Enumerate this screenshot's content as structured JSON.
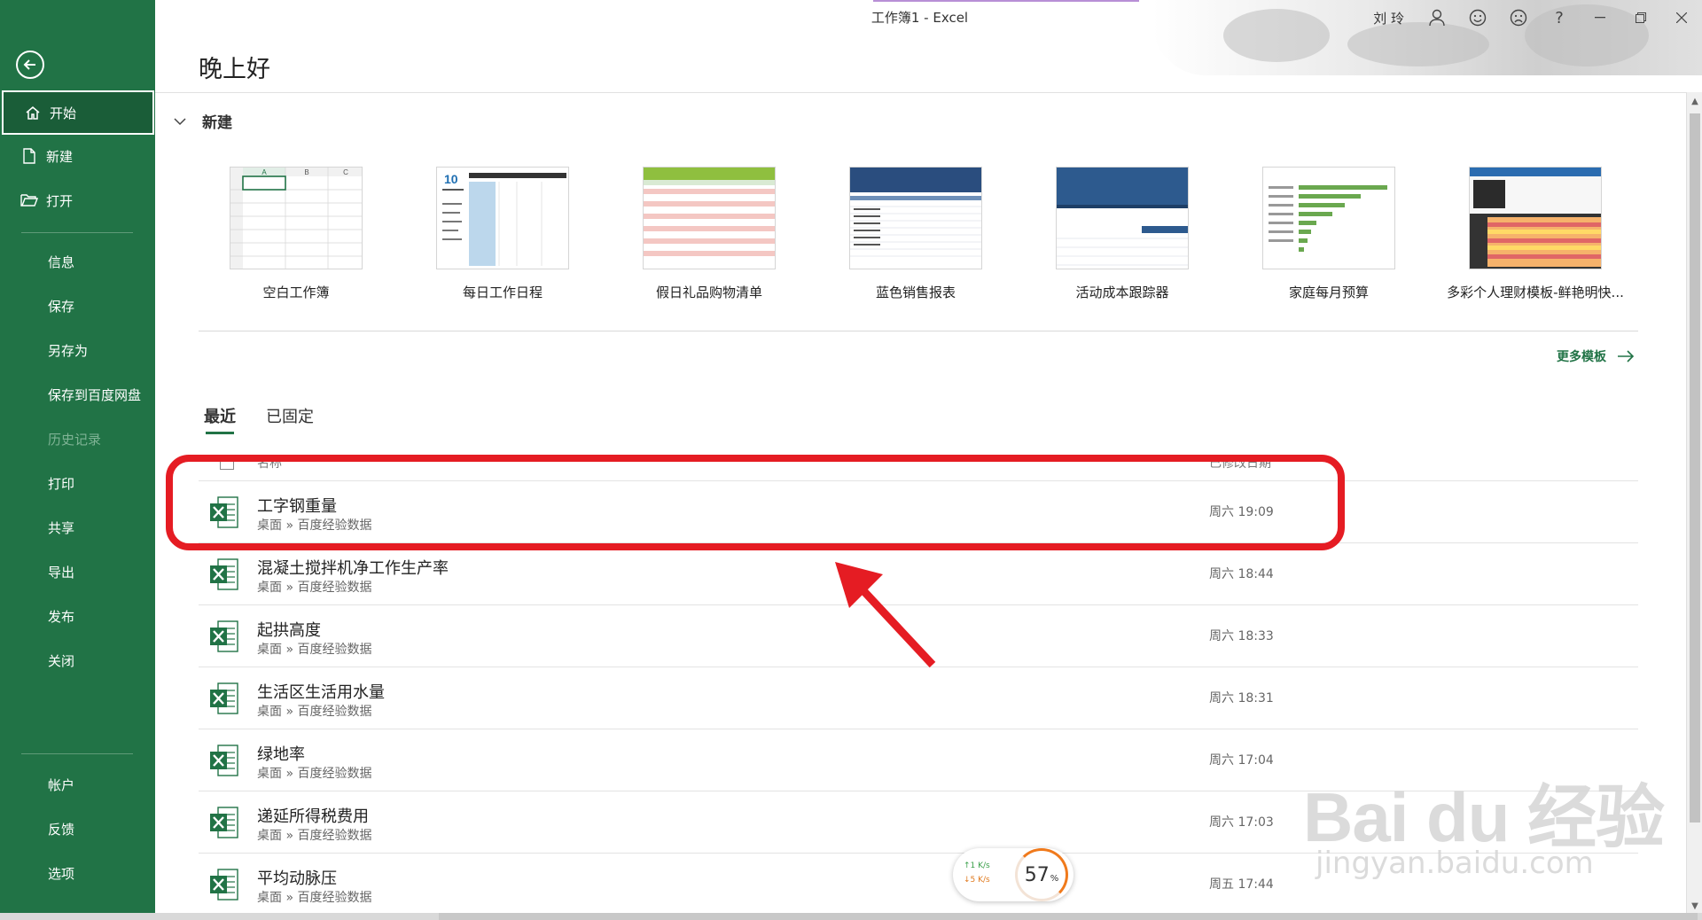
{
  "window": {
    "title": "工作簿1  -  Excel",
    "user": "刘 玲",
    "help": "?"
  },
  "sidebar": {
    "items": [
      {
        "label": "开始"
      },
      {
        "label": "新建"
      },
      {
        "label": "打开"
      },
      {
        "label": "信息"
      },
      {
        "label": "保存"
      },
      {
        "label": "另存为"
      },
      {
        "label": "保存到百度网盘"
      },
      {
        "label": "历史记录"
      },
      {
        "label": "打印"
      },
      {
        "label": "共享"
      },
      {
        "label": "导出"
      },
      {
        "label": "发布"
      },
      {
        "label": "关闭"
      },
      {
        "label": "帐户"
      },
      {
        "label": "反馈"
      },
      {
        "label": "选项"
      }
    ]
  },
  "main": {
    "greeting": "晚上好",
    "new_section": "新建",
    "more_templates": "更多模板",
    "templates": [
      {
        "name": "空白工作簿"
      },
      {
        "name": "每日工作日程"
      },
      {
        "name": "假日礼品购物清单"
      },
      {
        "name": "蓝色销售报表"
      },
      {
        "name": "活动成本跟踪器"
      },
      {
        "name": "家庭每月预算"
      },
      {
        "name": "多彩个人理财模板-鲜艳明快..."
      }
    ],
    "tabs": [
      {
        "label": "最近"
      },
      {
        "label": "已固定"
      }
    ],
    "list_header": {
      "name": "名称",
      "date": "已修改日期"
    },
    "files": [
      {
        "name": "工字钢重量",
        "path": "桌面 » 百度经验数据",
        "date": "周六 19:09"
      },
      {
        "name": "混凝土搅拌机净工作生产率",
        "path": "桌面 » 百度经验数据",
        "date": "周六 18:44"
      },
      {
        "name": "起拱高度",
        "path": "桌面 » 百度经验数据",
        "date": "周六 18:33"
      },
      {
        "name": "生活区生活用水量",
        "path": "桌面 » 百度经验数据",
        "date": "周六 18:31"
      },
      {
        "name": "绿地率",
        "path": "桌面 » 百度经验数据",
        "date": "周六 17:04"
      },
      {
        "name": "递延所得税费用",
        "path": "桌面 » 百度经验数据",
        "date": "周六 17:03"
      },
      {
        "name": "平均动脉压",
        "path": "桌面 » 百度经验数据",
        "date": "周五 17:44"
      }
    ]
  },
  "net_widget": {
    "up": "↑1  K/s",
    "down": "↓5  K/s",
    "percent": "57",
    "percent_sign": "%"
  },
  "watermark": {
    "brand": "Bai du 经验",
    "url": "jingyan.baidu.com"
  },
  "colors": {
    "excel_green": "#217346",
    "highlight_red": "#e51c23"
  }
}
